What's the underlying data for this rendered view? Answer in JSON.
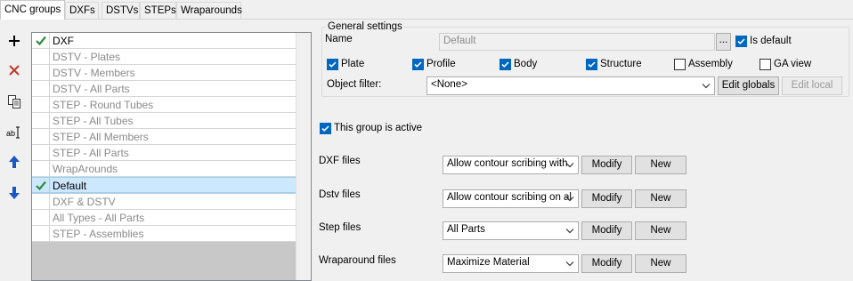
{
  "tabs": [
    {
      "label": "CNC groups",
      "active": true
    },
    {
      "label": "DXFs"
    },
    {
      "label": "DSTVs"
    },
    {
      "label": "STEPs"
    },
    {
      "label": "Wraparounds"
    }
  ],
  "toolbar": {
    "add": "plus-icon",
    "delete": "delete-icon",
    "copy": "copy-icon",
    "rename": "rename-icon",
    "move_up": "arrow-up-icon",
    "move_down": "arrow-down-icon",
    "colors": {
      "delete": "#c0392b",
      "arrows": "#1a56c4",
      "check": "#2e8b3d"
    }
  },
  "groups": [
    {
      "label": "DXF",
      "checked": true,
      "active": true
    },
    {
      "label": "DSTV - Plates"
    },
    {
      "label": "DSTV - Members"
    },
    {
      "label": "DSTV - All Parts"
    },
    {
      "label": "STEP - Round Tubes"
    },
    {
      "label": "STEP - All Tubes"
    },
    {
      "label": "STEP - All Members"
    },
    {
      "label": "STEP - All Parts"
    },
    {
      "label": "WrapArounds"
    },
    {
      "label": "Default",
      "checked": true,
      "active": true,
      "selected": true
    },
    {
      "label": "DXF & DSTV"
    },
    {
      "label": "All Types - All Parts"
    },
    {
      "label": "STEP - Assemblies"
    }
  ],
  "general": {
    "legend": "General settings",
    "name_label": "Name",
    "name_value": "Default",
    "browse_label": "...",
    "is_default_label": "Is default",
    "types": [
      {
        "label": "Plate",
        "checked": true
      },
      {
        "label": "Profile",
        "checked": true
      },
      {
        "label": "Body",
        "checked": true
      },
      {
        "label": "Structure",
        "checked": true
      },
      {
        "label": "Assembly",
        "checked": false
      },
      {
        "label": "GA view",
        "checked": false
      }
    ],
    "object_filter_label": "Object filter:",
    "object_filter_value": "<None>",
    "edit_globals_label": "Edit globals",
    "edit_local_label": "Edit local"
  },
  "active_label": "This group is active",
  "file_rows": [
    {
      "label": "DXF files",
      "value": "Allow contour scribing with",
      "modify": "Modify",
      "new": "New"
    },
    {
      "label": "Dstv files",
      "value": "Allow contour scribing on al",
      "modify": "Modify",
      "new": "New"
    },
    {
      "label": "Step files",
      "value": "All Parts",
      "modify": "Modify",
      "new": "New"
    },
    {
      "label": "Wraparound files",
      "value": "Maximize Material",
      "modify": "Modify",
      "new": "New"
    }
  ]
}
